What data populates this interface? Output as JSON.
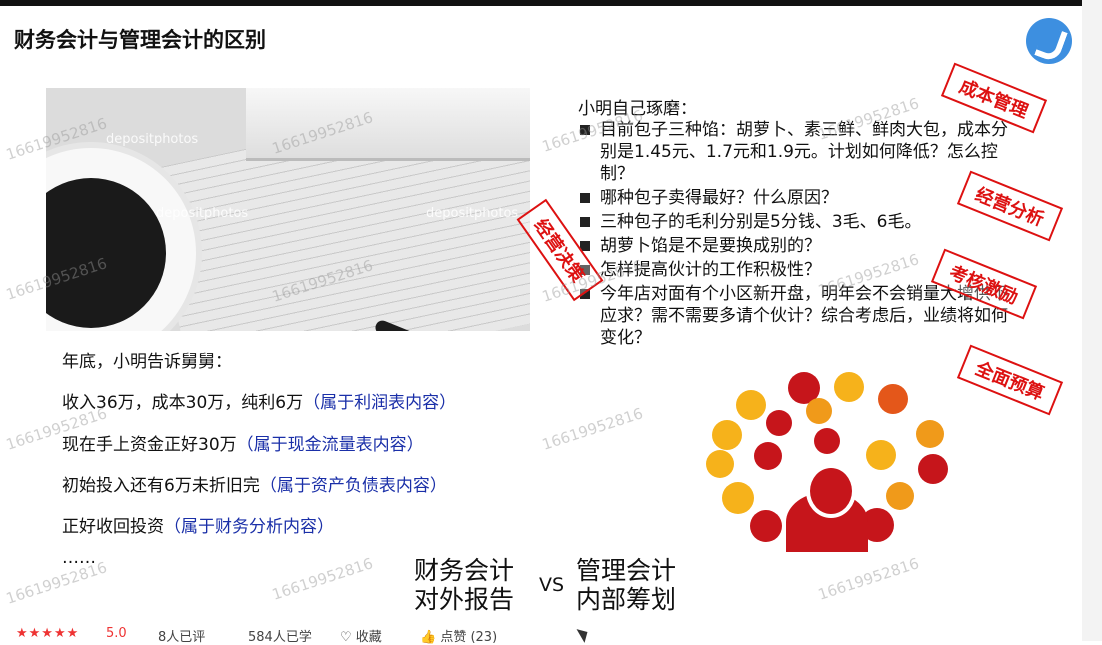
{
  "title": "财务会计与管理会计的区别",
  "photo_watermark": "depositphotos",
  "left": {
    "intro": "年底，小明告诉舅舅：",
    "lines": [
      {
        "text": "收入36万，成本30万，纯利6万",
        "note": "（属于利润表内容）"
      },
      {
        "text": "现在手上资金正好30万",
        "note": "（属于现金流量表内容）"
      },
      {
        "text": "初始投入还有6万未折旧完",
        "note": "（属于资产负债表内容）"
      },
      {
        "text": "正好收回投资",
        "note": "（属于财务分析内容）"
      }
    ],
    "ellipsis": "……"
  },
  "right": {
    "title": "小明自己琢磨：",
    "points": [
      "目前包子三种馅：胡萝卜、素三鲜、鲜肉大包，成本分别是1.45元、1.7元和1.9元。计划如何降低？怎么控制？",
      "哪种包子卖得最好？什么原因？",
      "三种包子的毛利分别是5分钱、3毛、6毛。",
      "胡萝卜馅是不是要换成别的？",
      "怎样提高伙计的工作积极性？",
      "今年店对面有个小区新开盘，明年会不会销量大增供不应求？需不需要多请个伙计？综合考虑后，业绩将如何变化？"
    ]
  },
  "stamps": {
    "cost": "成本管理",
    "operation": "经营分析",
    "assessment": "考核激励",
    "budget": "全面预算",
    "decision": "经营决策"
  },
  "compare": {
    "left_top": "财务会计",
    "left_bottom": "对外报告",
    "vs": "VS",
    "right_top": "管理会计",
    "right_bottom": "内部筹划"
  },
  "watermark": "16619952816",
  "footer": {
    "stars": "★★★★★",
    "rating": "5.0",
    "rated": "8人已评",
    "learned": "584人已学",
    "collect": "收藏",
    "like": "点赞 (23)"
  },
  "colors": {
    "stamp": "#dd1111",
    "note": "#1a2fa8",
    "accent": "#c6151b",
    "logo": "#3d8fe0"
  }
}
